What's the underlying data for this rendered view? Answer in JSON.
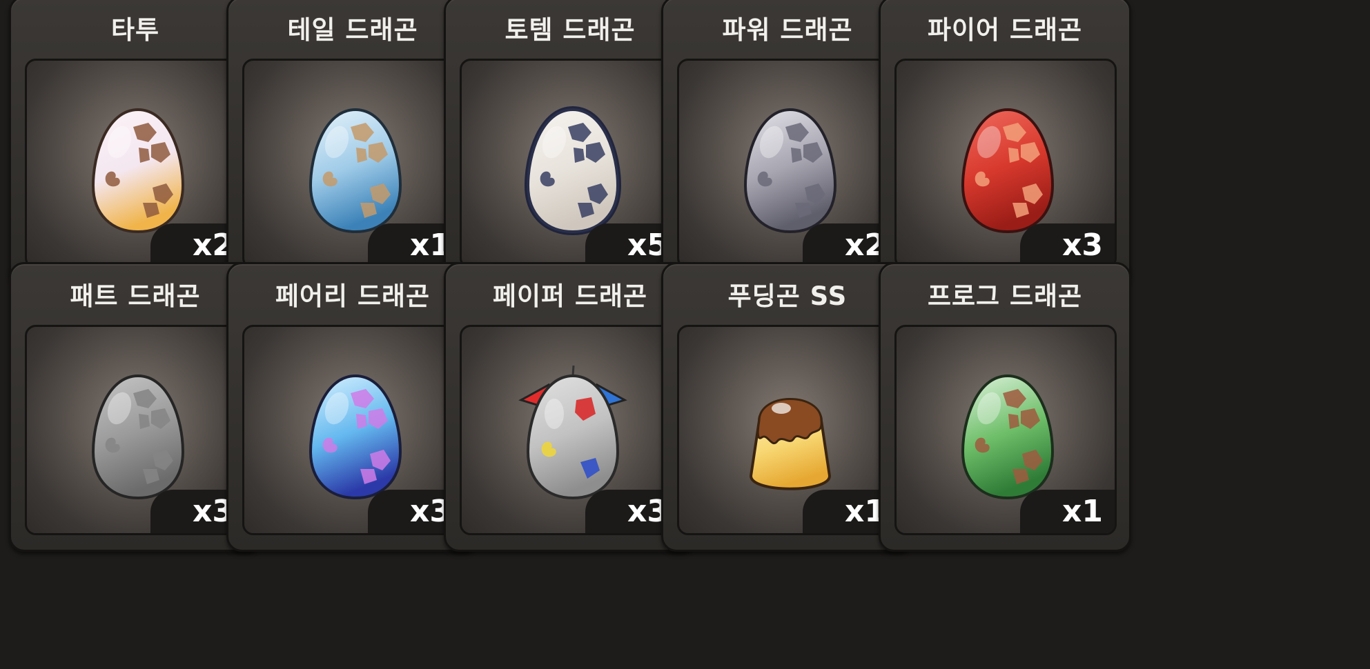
{
  "items": [
    {
      "name": "타투",
      "count": "x2",
      "egg": "tattoo-dragon-egg-icon",
      "colors": {
        "top": "#fbf3f7",
        "mid": "#f4e7f0",
        "bottom": "#f0b44a",
        "spot": "#8f5a3e",
        "outline": "#3a2a22"
      }
    },
    {
      "name": "테일 드래곤",
      "count": "x1",
      "egg": "tail-dragon-egg-icon",
      "colors": {
        "top": "#e7f3fb",
        "mid": "#9fcbe8",
        "bottom": "#3c82b8",
        "spot": "#c49a6a",
        "outline": "#1f2e3a"
      }
    },
    {
      "name": "토템 드래곤",
      "count": "x5",
      "egg": "totem-dragon-egg-icon",
      "colors": {
        "top": "#f6f3ef",
        "mid": "#e8e3dc",
        "bottom": "#cfc7bd",
        "spot": "#384063",
        "outline": "#2a2f4a"
      }
    },
    {
      "name": "파워 드래곤",
      "count": "x2",
      "egg": "power-dragon-egg-icon",
      "colors": {
        "top": "#e5e4ea",
        "mid": "#a7a6b1",
        "bottom": "#5f5e6b",
        "spot": "#6b6a79",
        "outline": "#23222a"
      }
    },
    {
      "name": "파이어 드래곤",
      "count": "x3",
      "egg": "fire-dragon-egg-icon",
      "colors": {
        "top": "#f06a5e",
        "mid": "#d8392d",
        "bottom": "#9a1d17",
        "spot": "#f2a07a",
        "outline": "#3a1210"
      }
    },
    {
      "name": "패트 드래곤",
      "count": "x3",
      "egg": "fat-dragon-egg-icon",
      "colors": {
        "top": "#c7c7c7",
        "mid": "#9a9a9a",
        "bottom": "#6b6b6b",
        "spot": "#858585",
        "outline": "#252525"
      }
    },
    {
      "name": "페어리 드래곤",
      "count": "x3",
      "egg": "fairy-dragon-egg-icon",
      "colors": {
        "top": "#d9f2ff",
        "mid": "#64b8ef",
        "bottom": "#2b3aa8",
        "spot": "#d07be8",
        "outline": "#1a1e3a"
      }
    },
    {
      "name": "페이퍼 드래곤",
      "count": "x3",
      "egg": "paper-dragon-egg-icon",
      "colors": {
        "top": "#e2e2e2",
        "mid": "#c2c2c2",
        "bottom": "#8e8e8e",
        "spot": "#d83b3b",
        "outline": "#2a2a2a",
        "flag_left": "#e22c2c",
        "flag_right": "#2f74d6"
      }
    },
    {
      "name": "푸딩곤 SS",
      "count": "x1",
      "egg": "pudding-dragon-egg-icon",
      "colors": {
        "top": "#fff2c2",
        "mid": "#f8d874",
        "bottom": "#e6a832",
        "spot": "#8a4a22",
        "outline": "#3a2410"
      }
    },
    {
      "name": "프로그 드래곤",
      "count": "x1",
      "egg": "frog-dragon-egg-icon",
      "colors": {
        "top": "#dff3de",
        "mid": "#6fbf6a",
        "bottom": "#2f7c37",
        "spot": "#a05a40",
        "outline": "#1c2e1c"
      }
    }
  ]
}
